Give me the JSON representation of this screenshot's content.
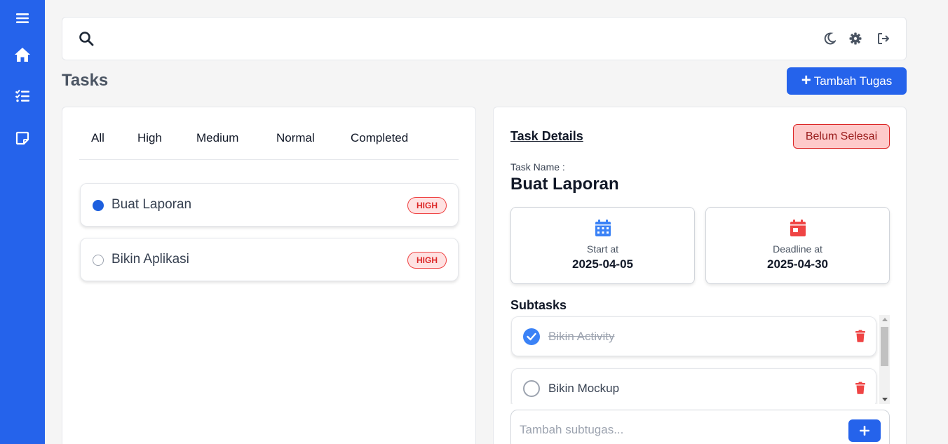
{
  "sidebar": {
    "icons": [
      "menu-icon",
      "home-icon",
      "task-list-icon",
      "note-icon"
    ]
  },
  "topbar": {
    "icons": [
      "search-icon",
      "moon-icon",
      "gear-icon",
      "logout-icon"
    ]
  },
  "page": {
    "title": "Tasks",
    "add_button_label": "Tambah Tugas"
  },
  "filters": {
    "tabs": [
      "All",
      "High",
      "Medium",
      "Normal",
      "Completed"
    ]
  },
  "tasks": [
    {
      "name": "Buat Laporan",
      "priority": "HIGH",
      "selected": true
    },
    {
      "name": "Bikin Aplikasi",
      "priority": "HIGH",
      "selected": false
    }
  ],
  "details": {
    "title": "Task Details",
    "status": "Belum Selesai",
    "name_label": "Task Name :",
    "name": "Buat Laporan",
    "start_label": "Start at",
    "start_date": "2025-04-05",
    "deadline_label": "Deadline at",
    "deadline_date": "2025-04-30",
    "subtasks_title": "Subtasks",
    "subtasks": [
      {
        "name": "Bikin Activity",
        "done": true
      },
      {
        "name": "Bikin Mockup",
        "done": false
      }
    ],
    "subtask_placeholder": "Tambah subtugas..."
  },
  "colors": {
    "primary": "#2563eb",
    "danger": "#ef4444",
    "start_icon": "#3b82f6",
    "deadline_icon": "#ef4444"
  }
}
